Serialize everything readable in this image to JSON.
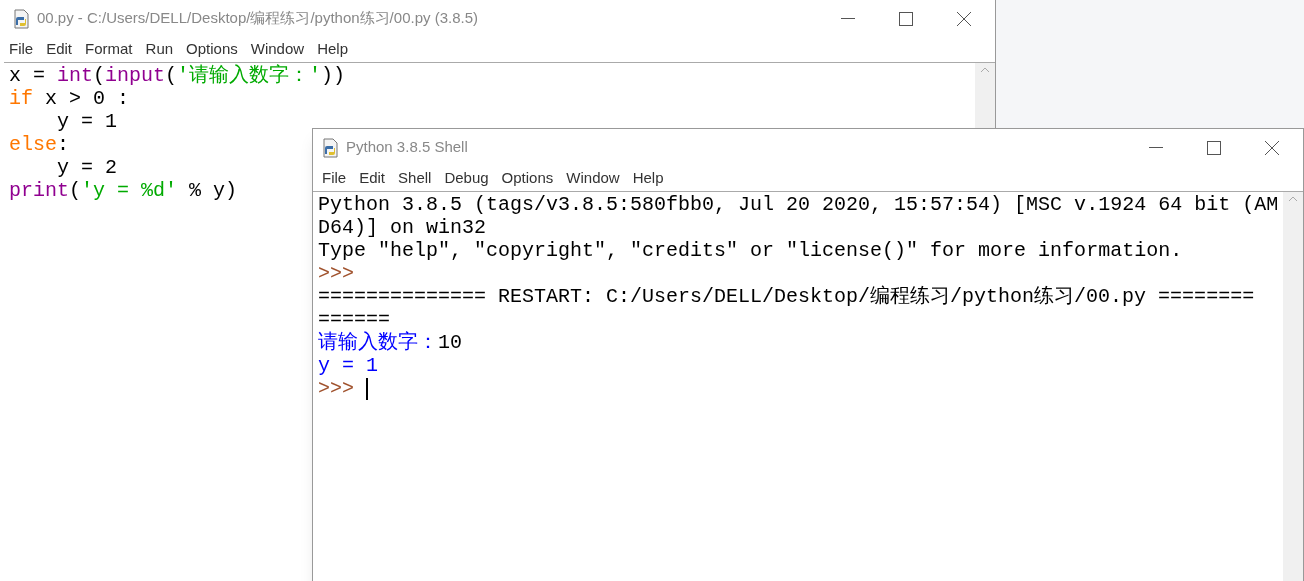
{
  "editor": {
    "title": "00.py - C:/Users/DELL/Desktop/编程练习/python练习/00.py (3.8.5)",
    "menu": [
      "File",
      "Edit",
      "Format",
      "Run",
      "Options",
      "Window",
      "Help"
    ],
    "lines": [
      [
        {
          "text": "x = ",
          "kind": "plain"
        },
        {
          "text": "int",
          "kind": "builtin"
        },
        {
          "text": "(",
          "kind": "plain"
        },
        {
          "text": "input",
          "kind": "builtin"
        },
        {
          "text": "(",
          "kind": "plain"
        },
        {
          "text": "'请输入数字：'",
          "kind": "string"
        },
        {
          "text": "))",
          "kind": "plain"
        }
      ],
      [
        {
          "text": "if",
          "kind": "keyword"
        },
        {
          "text": " x > 0 :",
          "kind": "plain"
        }
      ],
      [
        {
          "text": "    y = 1",
          "kind": "plain"
        }
      ],
      [
        {
          "text": "else",
          "kind": "keyword"
        },
        {
          "text": ":",
          "kind": "plain"
        }
      ],
      [
        {
          "text": "    y = 2",
          "kind": "plain"
        }
      ],
      [
        {
          "text": "print",
          "kind": "builtin"
        },
        {
          "text": "(",
          "kind": "plain"
        },
        {
          "text": "'y = %d'",
          "kind": "string"
        },
        {
          "text": " % y)",
          "kind": "plain"
        }
      ]
    ]
  },
  "shell": {
    "title": "Python 3.8.5 Shell",
    "menu": [
      "File",
      "Edit",
      "Shell",
      "Debug",
      "Options",
      "Window",
      "Help"
    ],
    "cursor": true,
    "lines": [
      [
        {
          "text": "Python 3.8.5 (tags/v3.8.5:580fbb0, Jul 20 2020, 15:57:54) [MSC v.1924 64 bit (AM",
          "kind": "plain"
        }
      ],
      [
        {
          "text": "D64)] on win32",
          "kind": "plain"
        }
      ],
      [
        {
          "text": "Type \"help\", \"copyright\", \"credits\" or \"license()\" for more information.",
          "kind": "plain"
        }
      ],
      [
        {
          "text": ">>>",
          "kind": "prompt"
        }
      ],
      [
        {
          "text": "============== RESTART: C:/Users/DELL/Desktop/编程练习/python练习/00.py ========",
          "kind": "plain"
        }
      ],
      [
        {
          "text": "======",
          "kind": "plain"
        }
      ],
      [
        {
          "text": "请输入数字：",
          "kind": "stdout"
        },
        {
          "text": "10",
          "kind": "plain"
        }
      ],
      [
        {
          "text": "y = 1",
          "kind": "stdout"
        }
      ],
      [
        {
          "text": ">>>",
          "kind": "prompt"
        }
      ]
    ]
  }
}
